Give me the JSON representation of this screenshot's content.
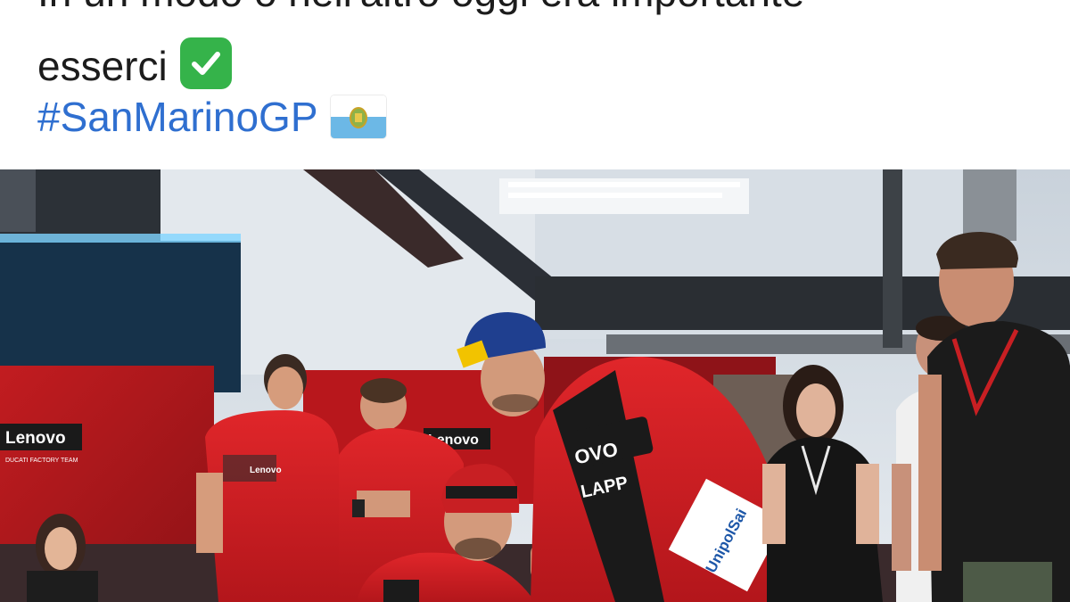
{
  "post": {
    "partial_line": "In un modo o nell'altro oggi era importante",
    "line_main": "esserci",
    "check_emoji": "✅",
    "hashtag": "#SanMarinoGP",
    "flag_emoji": "🇸🇲"
  },
  "photo": {
    "wall_logo": "Lenovo",
    "wall_logo_sub": "DUCATI FACTORY TEAM",
    "wall_logo_2": "Lenovo",
    "suit_text_1": "OVO",
    "suit_text_2": "LAPP",
    "suit_text_3": "UnipolSai",
    "suit_text_4": "Lenovo"
  },
  "colors": {
    "text": "#1c1c1c",
    "hashtag": "#2f6fd0",
    "ducati_red": "#d31f22",
    "check_green": "#35b34a"
  }
}
